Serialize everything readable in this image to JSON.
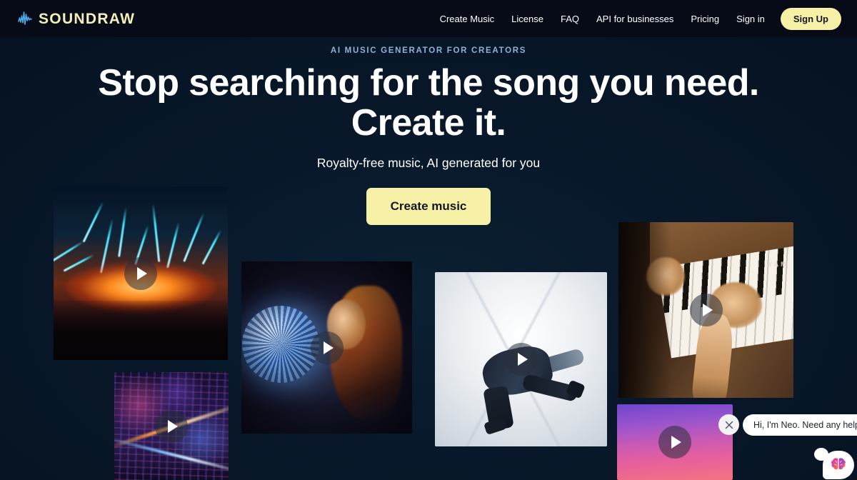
{
  "brand": {
    "name": "SOUNDRAW",
    "logo_icon": "waveform-icon",
    "logo_color": "#f4efb8",
    "wave_color": "#4ea8e0"
  },
  "nav": {
    "links": [
      {
        "label": "Create Music"
      },
      {
        "label": "License"
      },
      {
        "label": "FAQ"
      },
      {
        "label": "API for businesses"
      },
      {
        "label": "Pricing"
      },
      {
        "label": "Sign in"
      }
    ],
    "signup_label": "Sign Up"
  },
  "hero": {
    "eyebrow": "AI MUSIC GENERATOR FOR CREATORS",
    "headline_line1": "Stop searching for the song you need.",
    "headline_line2": "Create it.",
    "subhead": "Royalty-free music, AI generated for you",
    "cta_label": "Create music"
  },
  "cards": [
    {
      "name": "concert-lights-card",
      "alt": "Concert with cyan light beams and orange stage glow over a crowd",
      "play_icon": "play-icon"
    },
    {
      "name": "city-neon-card",
      "alt": "Aerial neon cyberpunk cityscape at night",
      "play_icon": "play-icon"
    },
    {
      "name": "disco-ball-card",
      "alt": "Woman holding a glowing disco ball",
      "play_icon": "play-icon"
    },
    {
      "name": "dancer-card",
      "alt": "Breakdancer mid-move in a bright white corridor",
      "play_icon": "play-icon"
    },
    {
      "name": "piano-card",
      "alt": "Hands playing a wooden Yamaha upright piano",
      "play_icon": "play-icon"
    },
    {
      "name": "tropical-sunset-card",
      "alt": "Palm tree silhouettes against a purple and pink sunset sky",
      "play_icon": "play-icon"
    }
  ],
  "piano": {
    "brand_text": "YAM"
  },
  "chat": {
    "message": "Hi, I'm Neo. Need any help?",
    "close_icon": "close-icon",
    "avatar_icon": "brain-icon"
  },
  "colors": {
    "page_bg": "#061321",
    "header_bg": "#070b18",
    "accent_yellow": "#f7f1a8",
    "eyebrow_blue": "#8fb3d8",
    "text_white": "#ffffff"
  }
}
